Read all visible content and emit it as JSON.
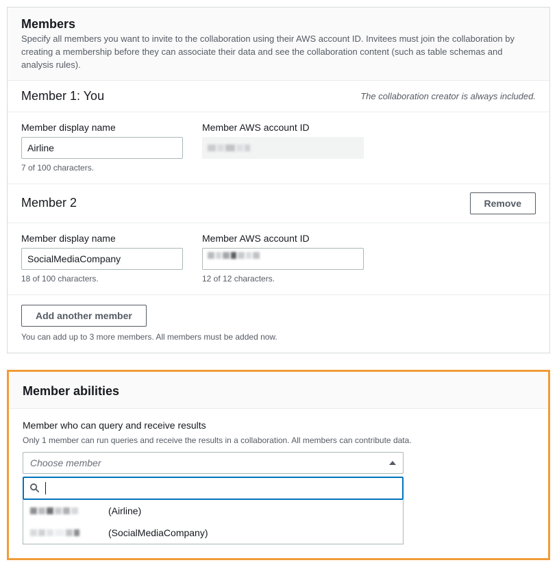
{
  "members_panel": {
    "title": "Members",
    "description": "Specify all members you want to invite to the collaboration using their AWS account ID. Invitees must join the collaboration by creating a membership before they can associate their data and see the collaboration content (such as table schemas and analysis rules)."
  },
  "member1": {
    "heading": "Member 1: You",
    "note": "The collaboration creator is always included.",
    "display_name_label": "Member display name",
    "display_name_value": "Airline",
    "display_name_counter": "7 of 100 characters.",
    "account_id_label": "Member AWS account ID"
  },
  "member2": {
    "heading": "Member 2",
    "remove_label": "Remove",
    "display_name_label": "Member display name",
    "display_name_value": "SocialMediaCompany",
    "display_name_counter": "18 of 100 characters.",
    "account_id_label": "Member AWS account ID",
    "account_id_counter": "12 of 12 characters."
  },
  "add_member": {
    "button_label": "Add another member",
    "hint": "You can add up to 3 more members. All members must be added now."
  },
  "abilities": {
    "title": "Member abilities",
    "field_label": "Member who can query and receive results",
    "field_desc": "Only 1 member can run queries and receive the results in a collaboration. All members can contribute data.",
    "placeholder": "Choose member",
    "options": [
      {
        "label": "(Airline)"
      },
      {
        "label": "(SocialMediaCompany)"
      }
    ]
  }
}
